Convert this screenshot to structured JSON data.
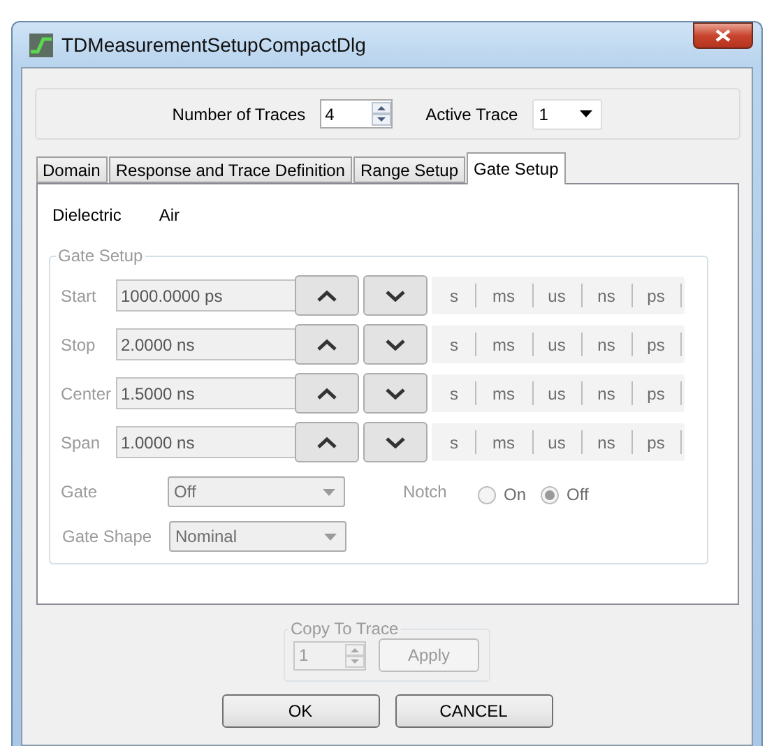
{
  "window": {
    "title": "TDMeasurementSetupCompactDlg"
  },
  "header": {
    "number_of_traces": {
      "label": "Number of Traces",
      "value": "4"
    },
    "active_trace": {
      "label": "Active Trace",
      "value": "1"
    }
  },
  "tabs": [
    {
      "label": "Domain",
      "selected": false
    },
    {
      "label": "Response and Trace Definition",
      "selected": false
    },
    {
      "label": "Range Setup",
      "selected": false
    },
    {
      "label": "Gate Setup",
      "selected": true
    }
  ],
  "dielectric": {
    "label": "Dielectric",
    "value": "Air"
  },
  "gate_setup": {
    "title": "Gate Setup",
    "disabled": true,
    "rows": [
      {
        "label": "Start",
        "value": "1000.0000 ps",
        "units": [
          "s",
          "ms",
          "us",
          "ns",
          "ps"
        ]
      },
      {
        "label": "Stop",
        "value": "2.0000 ns",
        "units": [
          "s",
          "ms",
          "us",
          "ns",
          "ps"
        ]
      },
      {
        "label": "Center",
        "value": "1.5000 ns",
        "units": [
          "s",
          "ms",
          "us",
          "ns",
          "ps"
        ]
      },
      {
        "label": "Span",
        "value": "1.0000 ns",
        "units": [
          "s",
          "ms",
          "us",
          "ns",
          "ps"
        ]
      }
    ],
    "gate": {
      "label": "Gate",
      "value": "Off"
    },
    "notch": {
      "label": "Notch",
      "options": [
        {
          "label": "On",
          "selected": false
        },
        {
          "label": "Off",
          "selected": true
        }
      ]
    },
    "gate_shape": {
      "label": "Gate Shape",
      "value": "Nominal"
    }
  },
  "copy_to_trace": {
    "title": "Copy To Trace",
    "value": "1",
    "button": "Apply",
    "disabled": true
  },
  "buttons": [
    "OK",
    "CANCEL"
  ]
}
